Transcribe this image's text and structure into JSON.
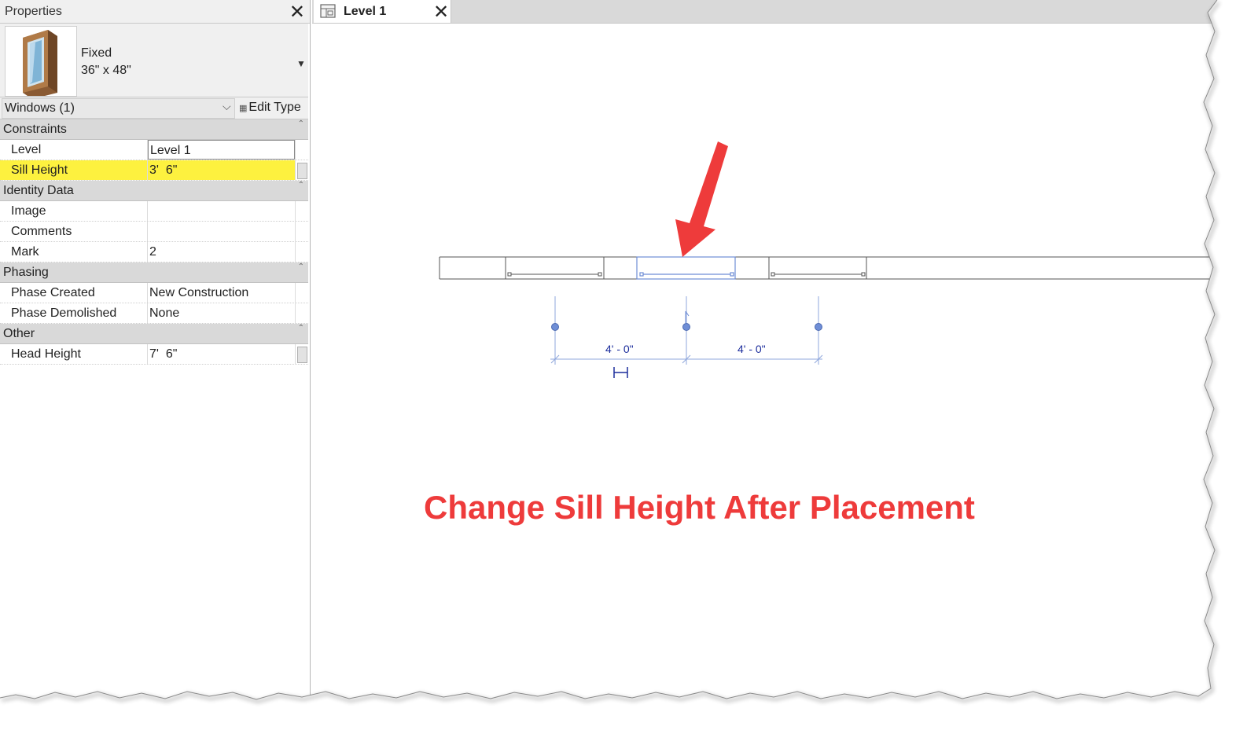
{
  "properties": {
    "title": "Properties",
    "type": {
      "name": "Fixed",
      "size": "36\" x 48\""
    },
    "filter": {
      "value": "Windows (1)",
      "edit_type_label": "Edit Type"
    },
    "groups": [
      {
        "label": "Constraints",
        "rows": [
          {
            "name": "Level",
            "value": "Level 1"
          },
          {
            "name": "Sill Height",
            "value": "3'  6\""
          }
        ]
      },
      {
        "label": "Identity Data",
        "rows": [
          {
            "name": "Image",
            "value": ""
          },
          {
            "name": "Comments",
            "value": ""
          },
          {
            "name": "Mark",
            "value": "2"
          }
        ]
      },
      {
        "label": "Phasing",
        "rows": [
          {
            "name": "Phase Created",
            "value": "New Construction"
          },
          {
            "name": "Phase Demolished",
            "value": "None"
          }
        ]
      },
      {
        "label": "Other",
        "rows": [
          {
            "name": "Head Height",
            "value": "7'  6\""
          }
        ]
      }
    ]
  },
  "view": {
    "tab_label": "Level 1",
    "dimensions": [
      "4' - 0\"",
      "4' - 0\""
    ],
    "caption": "Change Sill Height After Placement"
  },
  "colors": {
    "highlight": "#fdf13f",
    "annotation_red": "#ee3b3b",
    "dimension_blue": "#1c2d9c",
    "selection_blue": "#6f8ed6"
  }
}
